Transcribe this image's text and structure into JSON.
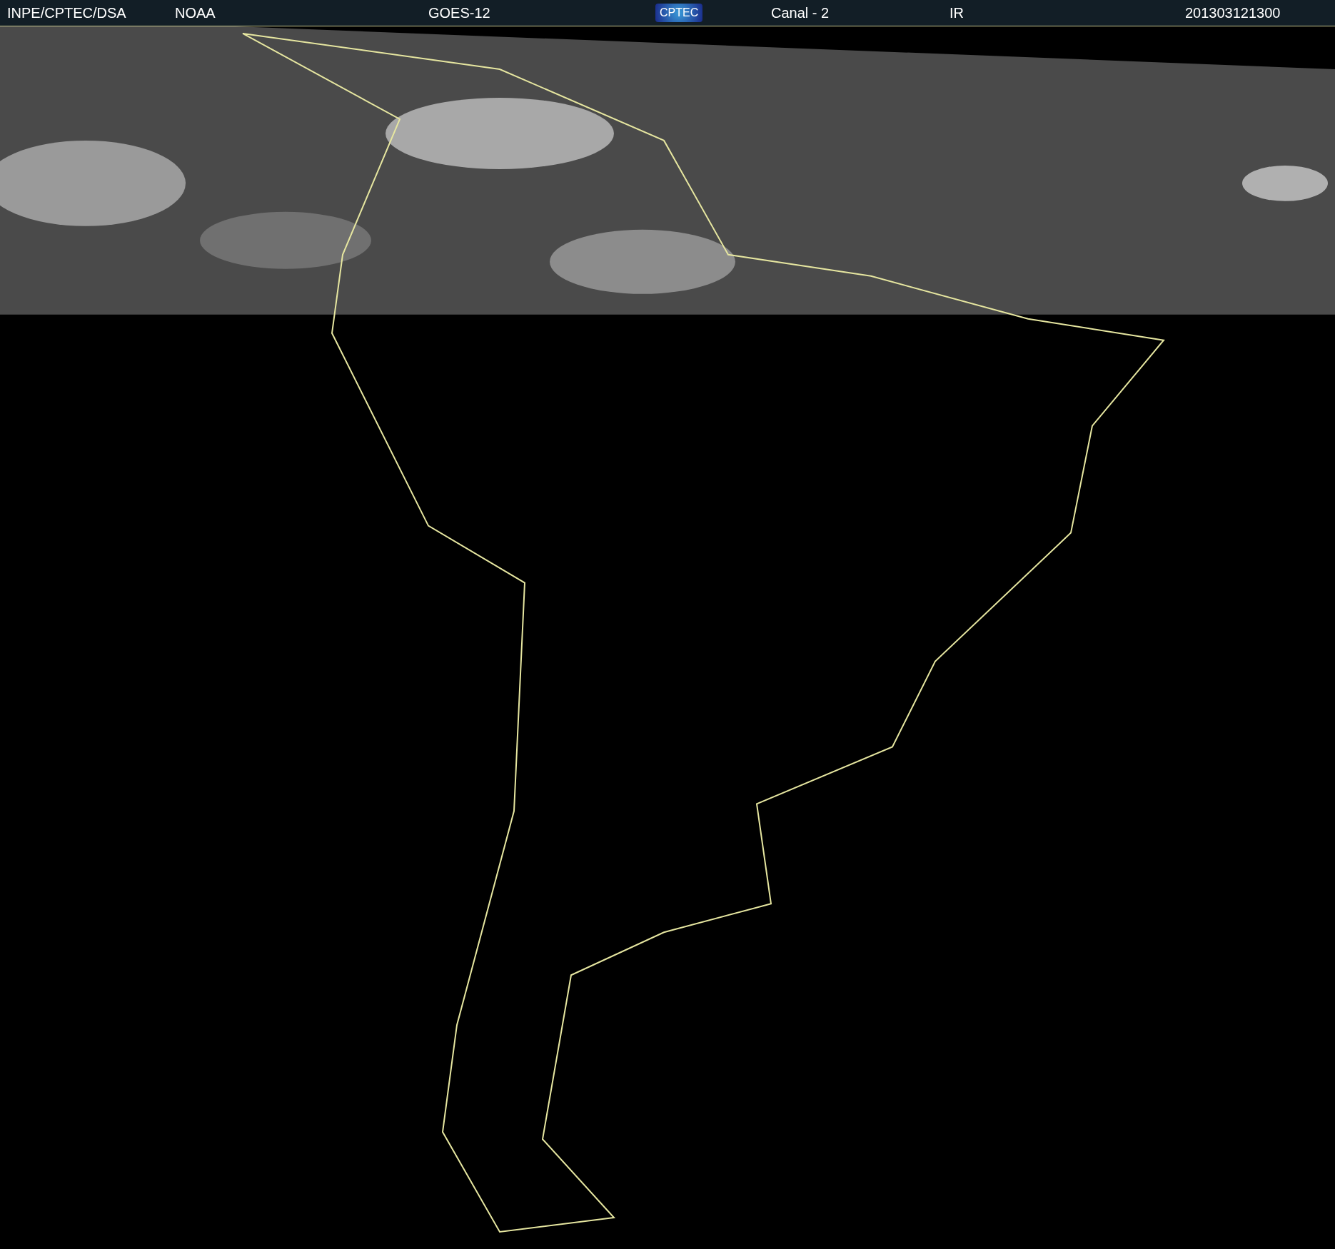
{
  "header": {
    "items": [
      {
        "kind": "text",
        "text": "INPE/CPTEC/DSA"
      },
      {
        "kind": "text",
        "text": "NOAA"
      },
      {
        "kind": "text",
        "text": "GOES-12"
      },
      {
        "kind": "logo",
        "text": "CPTEC"
      },
      {
        "kind": "text",
        "text": "Canal - 2"
      },
      {
        "kind": "text",
        "text": "IR"
      },
      {
        "kind": "text",
        "text": "201303121300"
      }
    ]
  }
}
